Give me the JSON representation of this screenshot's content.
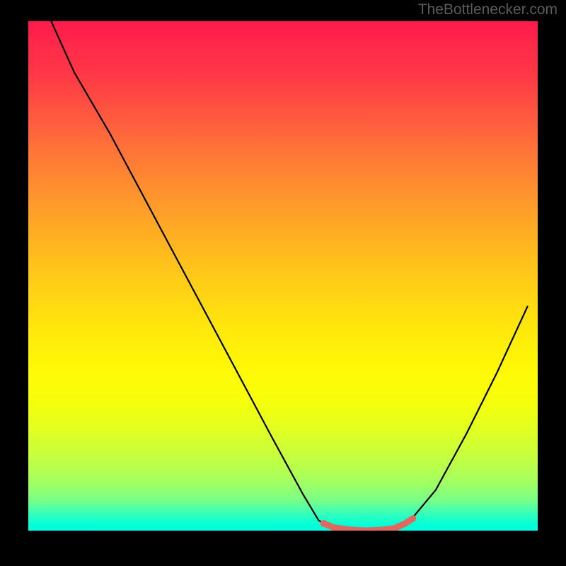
{
  "watermark": "TheBottlenecker.com",
  "chart_data": {
    "type": "line",
    "title": "",
    "xlabel": "",
    "ylabel": "",
    "xlim": [
      0,
      100
    ],
    "ylim": [
      0,
      100
    ],
    "grid": false,
    "curve": {
      "name": "bottleneck-curve",
      "color": "#000000",
      "points": [
        {
          "x": 4.5,
          "y": 100
        },
        {
          "x": 9,
          "y": 90
        },
        {
          "x": 16,
          "y": 78
        },
        {
          "x": 24,
          "y": 63
        },
        {
          "x": 32,
          "y": 48
        },
        {
          "x": 40,
          "y": 33
        },
        {
          "x": 48,
          "y": 18
        },
        {
          "x": 54,
          "y": 7
        },
        {
          "x": 57,
          "y": 2
        },
        {
          "x": 60,
          "y": 0.3
        },
        {
          "x": 66,
          "y": 0
        },
        {
          "x": 72,
          "y": 0.3
        },
        {
          "x": 75,
          "y": 2
        },
        {
          "x": 80,
          "y": 8
        },
        {
          "x": 86,
          "y": 19
        },
        {
          "x": 92,
          "y": 31
        },
        {
          "x": 98,
          "y": 44
        }
      ]
    },
    "highlight": {
      "name": "valley-highlight",
      "color": "#e0695f",
      "points": [
        {
          "x": 58,
          "y": 1.4
        },
        {
          "x": 60,
          "y": 0.6
        },
        {
          "x": 63,
          "y": 0.2
        },
        {
          "x": 66,
          "y": 0
        },
        {
          "x": 69,
          "y": 0.1
        },
        {
          "x": 72,
          "y": 0.5
        },
        {
          "x": 74,
          "y": 1.4
        },
        {
          "x": 75.5,
          "y": 2.4
        }
      ]
    },
    "gradient_description": "vertical gradient from red (top) through orange, yellow to green (bottom) representing bottleneck severity"
  }
}
